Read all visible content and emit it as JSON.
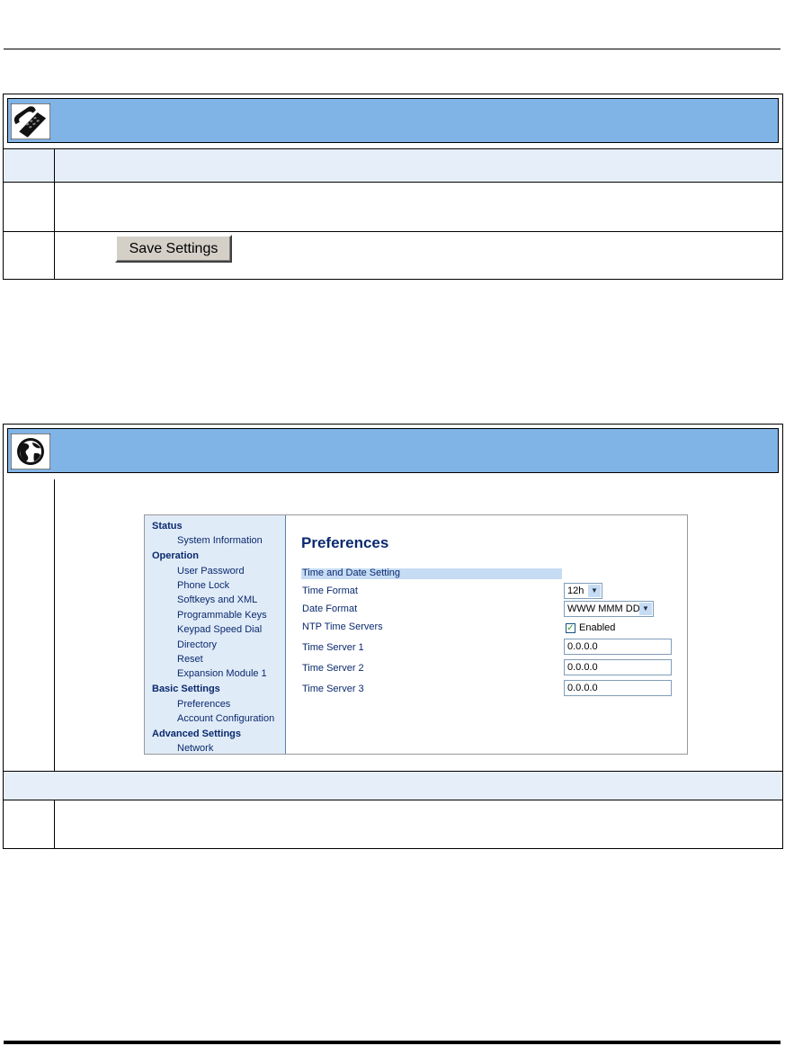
{
  "panel1": {
    "icon": "desk-phone-icon",
    "button_label": "Save Settings"
  },
  "panel2": {
    "icon": "web-browser-icon",
    "web_ui": {
      "nav": [
        {
          "label": "Status",
          "type": "head"
        },
        {
          "label": "System Information",
          "type": "item"
        },
        {
          "label": "Operation",
          "type": "head"
        },
        {
          "label": "User Password",
          "type": "item"
        },
        {
          "label": "Phone Lock",
          "type": "item"
        },
        {
          "label": "Softkeys and XML",
          "type": "item"
        },
        {
          "label": "Programmable Keys",
          "type": "item"
        },
        {
          "label": "Keypad Speed Dial",
          "type": "item"
        },
        {
          "label": "Directory",
          "type": "item"
        },
        {
          "label": "Reset",
          "type": "item"
        },
        {
          "label": "Expansion Module 1",
          "type": "item"
        },
        {
          "label": "Basic Settings",
          "type": "head"
        },
        {
          "label": "Preferences",
          "type": "item"
        },
        {
          "label": "Account Configuration",
          "type": "item"
        },
        {
          "label": "Advanced Settings",
          "type": "head"
        },
        {
          "label": "Network",
          "type": "item"
        }
      ],
      "title": "Preferences",
      "section": "Time and Date Setting",
      "fields": {
        "time_format": {
          "label": "Time Format",
          "value": "12h"
        },
        "date_format": {
          "label": "Date Format",
          "value": "WWW MMM DD"
        },
        "ntp": {
          "label": "NTP Time Servers",
          "checkbox_label": "Enabled",
          "checked": true
        },
        "server1": {
          "label": "Time Server 1",
          "value": "0.0.0.0"
        },
        "server2": {
          "label": "Time Server 2",
          "value": "0.0.0.0"
        },
        "server3": {
          "label": "Time Server 3",
          "value": "0.0.0.0"
        }
      }
    }
  },
  "colors": {
    "header_blue": "#80b3e6",
    "row_fill": "#e6eefa",
    "nav_bg": "#e0ebf8",
    "nav_text": "#0a2a6e"
  }
}
